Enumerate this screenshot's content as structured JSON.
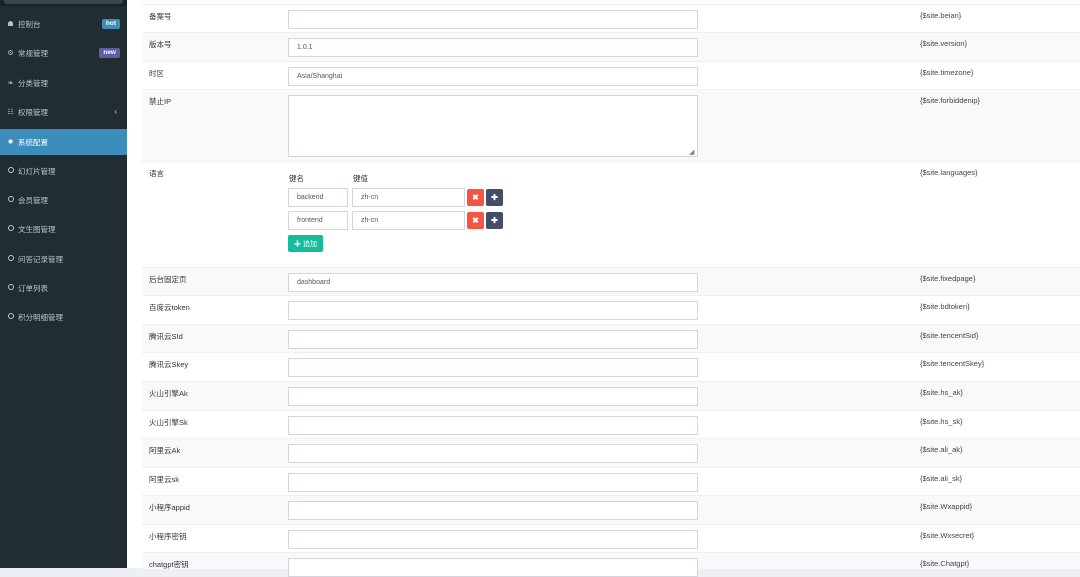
{
  "sidebar": {
    "items": [
      {
        "label": "控制台",
        "icon": "dashboard-icon",
        "glyph": "☗",
        "badge": "hot"
      },
      {
        "label": "常规管理",
        "icon": "cogs-icon",
        "glyph": "⚙",
        "badge": "new"
      },
      {
        "label": "分类管理",
        "icon": "leaf-icon",
        "glyph": "❧"
      },
      {
        "label": "权限管理",
        "icon": "group-icon",
        "glyph": "☷",
        "chevron": "‹"
      },
      {
        "label": "系统配置",
        "icon": "gear-icon",
        "glyph": "✹",
        "active": true
      },
      {
        "label": "幻灯片管理",
        "icon": "circle-icon"
      },
      {
        "label": "会员管理",
        "icon": "circle-icon"
      },
      {
        "label": "文生图管理",
        "icon": "circle-icon"
      },
      {
        "label": "问答记录管理",
        "icon": "circle-icon"
      },
      {
        "label": "订单列表",
        "icon": "circle-icon"
      },
      {
        "label": "积分明细管理",
        "icon": "circle-icon"
      }
    ]
  },
  "config": {
    "beian": {
      "label": "备案号",
      "value": "",
      "tip": "{$site.beian}"
    },
    "version": {
      "label": "版本号",
      "value": "1.0.1",
      "tip": "{$site.version}"
    },
    "timezone": {
      "label": "时区",
      "value": "Asia/Shanghai",
      "tip": "{$site.timezone}"
    },
    "forbiddenip": {
      "label": "禁止IP",
      "value": "",
      "tip": "{$site.forbiddenip}"
    },
    "languages": {
      "label": "语言",
      "tip": "{$site.languages}",
      "key_header": "键名",
      "value_header": "键值",
      "rows": [
        {
          "key": "backend",
          "value": "zh-cn"
        },
        {
          "key": "frontend",
          "value": "zh-cn"
        }
      ],
      "delete_glyph": "✖",
      "drag_glyph": "✚",
      "add_label": "✚ 追加"
    },
    "fixedpage": {
      "label": "后台固定页",
      "value": "dashboard",
      "tip": "{$site.fixedpage}"
    },
    "bdtoken": {
      "label": "百度云token",
      "value": "",
      "tip": "{$site.bdtoken}"
    },
    "tencentSid": {
      "label": "腾讯云SId",
      "value": "",
      "tip": "{$site.tencentSid}"
    },
    "tencentSkey": {
      "label": "腾讯云Skey",
      "value": "",
      "tip": "{$site.tencentSkey}"
    },
    "hs_ak": {
      "label": "火山引擎Ak",
      "value": "",
      "tip": "{$site.hs_ak}"
    },
    "hs_sk": {
      "label": "火山引擎Sk",
      "value": "",
      "tip": "{$site.hs_sk}"
    },
    "ali_ak": {
      "label": "阿里云Ak",
      "value": "",
      "tip": "{$site.ali_ak}"
    },
    "ali_sk": {
      "label": "阿里云sk",
      "value": "",
      "tip": "{$site.ali_sk}"
    },
    "wxappid": {
      "label": "小程序appid",
      "value": "",
      "tip": "{$site.Wxappid}"
    },
    "wxsecret": {
      "label": "小程序密钥",
      "value": "",
      "tip": "{$site.Wxsecret}"
    },
    "chatgpt": {
      "label": "chatgpt密钥",
      "value": "",
      "tip": "{$site.Chatgpt}"
    }
  }
}
